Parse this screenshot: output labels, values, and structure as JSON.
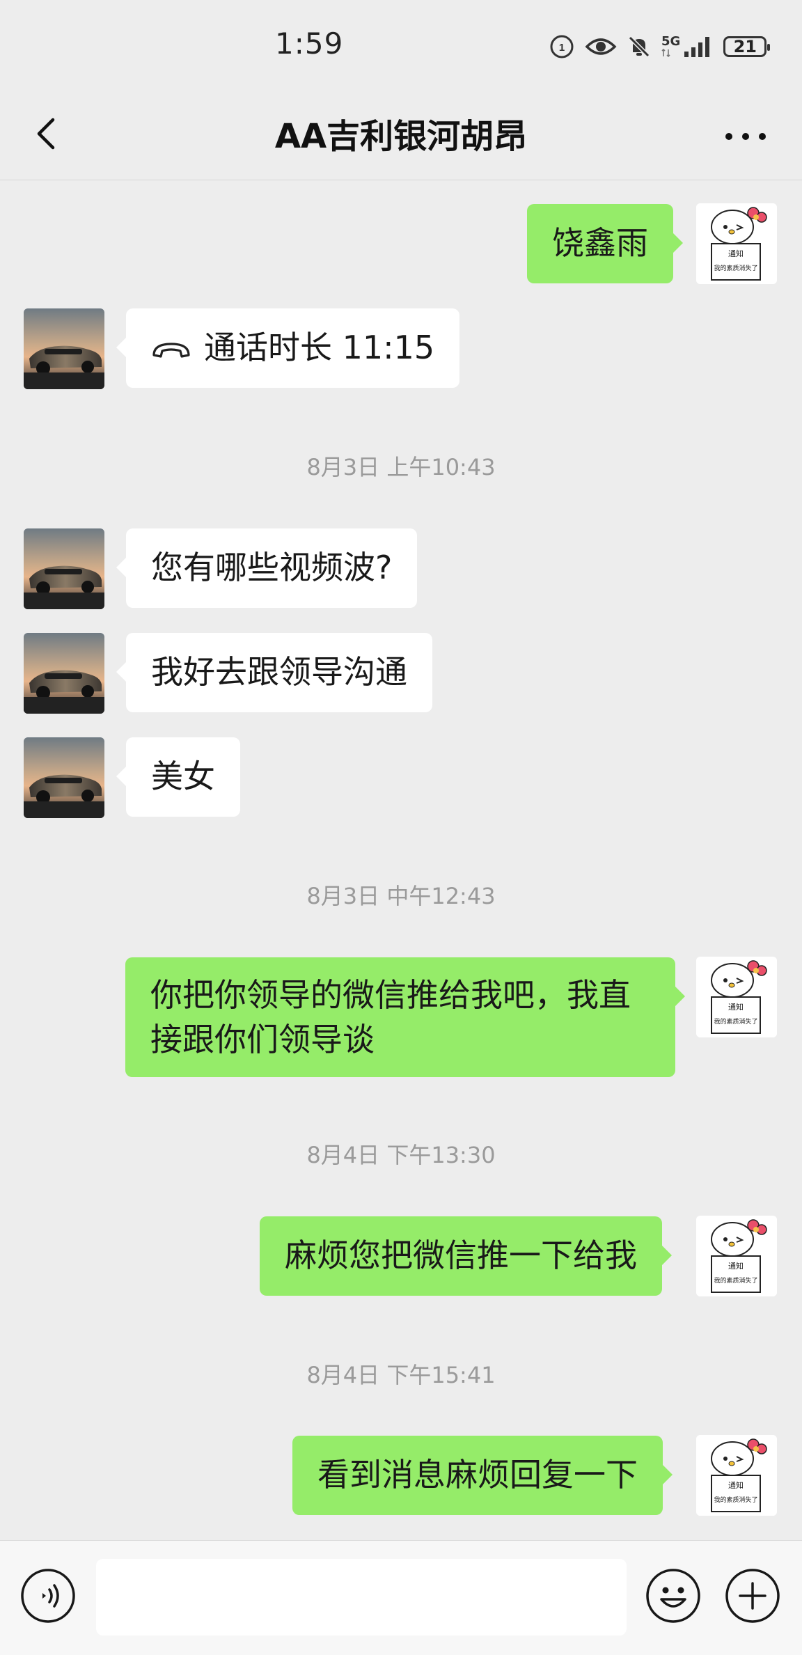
{
  "status_bar": {
    "time": "1:59",
    "network": "5G",
    "battery": "21"
  },
  "nav": {
    "title": "AA吉利银河胡昂"
  },
  "messages": [
    {
      "side": "out",
      "text": "饶鑫雨"
    },
    {
      "side": "in",
      "type": "call",
      "text": "通话时长 11:15"
    },
    {
      "type": "time",
      "text": "8月3日 上午10:43"
    },
    {
      "side": "in",
      "text": "您有哪些视频波?"
    },
    {
      "side": "in",
      "text": "我好去跟领导沟通"
    },
    {
      "side": "in",
      "text": "美女"
    },
    {
      "type": "time",
      "text": "8月3日 中午12:43"
    },
    {
      "side": "out",
      "text_line1": "你把你领导的微信推给我吧，我直",
      "text_line2": "接跟你们领导谈"
    },
    {
      "type": "time",
      "text": "8月4日 下午13:30"
    },
    {
      "side": "out",
      "text": "麻烦您把微信推一下给我"
    },
    {
      "type": "time",
      "text": "8月4日 下午15:41"
    },
    {
      "side": "out",
      "text": "看到消息麻烦回复一下"
    }
  ],
  "self_avatar": {
    "caption_top": "通知",
    "caption_bottom": "我的素质消失了"
  },
  "colors": {
    "outgoing_bubble": "#95ec69",
    "incoming_bubble": "#ffffff",
    "background": "#ededed"
  },
  "icons": {
    "back": "chevron-left-icon",
    "more": "more-dots-icon",
    "voice": "voice-icon",
    "emoji": "emoji-icon",
    "plus": "plus-icon"
  }
}
